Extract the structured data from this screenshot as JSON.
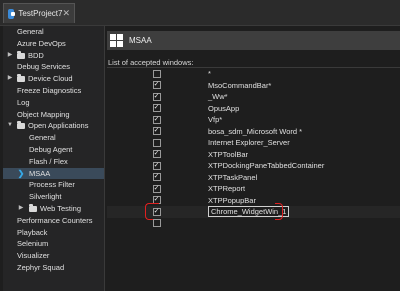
{
  "tab": {
    "title": "TestProject7",
    "close": "✕"
  },
  "sidebar": {
    "items": [
      {
        "label": "General",
        "level": 0,
        "arrow": "",
        "folder": false,
        "selected": false
      },
      {
        "label": "Azure DevOps",
        "level": 0,
        "arrow": "",
        "folder": false,
        "selected": false
      },
      {
        "label": "BDD",
        "level": 0,
        "arrow": "▶",
        "folder": true,
        "selected": false
      },
      {
        "label": "Debug Services",
        "level": 0,
        "arrow": "",
        "folder": false,
        "selected": false
      },
      {
        "label": "Device Cloud",
        "level": 0,
        "arrow": "▶",
        "folder": true,
        "selected": false
      },
      {
        "label": "Freeze Diagnostics",
        "level": 0,
        "arrow": "",
        "folder": false,
        "selected": false
      },
      {
        "label": "Log",
        "level": 0,
        "arrow": "",
        "folder": false,
        "selected": false
      },
      {
        "label": "Object Mapping",
        "level": 0,
        "arrow": "",
        "folder": false,
        "selected": false
      },
      {
        "label": "Open Applications",
        "level": 0,
        "arrow": "▼",
        "folder": true,
        "selected": false
      },
      {
        "label": "General",
        "level": 1,
        "arrow": "",
        "folder": false,
        "selected": false
      },
      {
        "label": "Debug Agent",
        "level": 1,
        "arrow": "",
        "folder": false,
        "selected": false
      },
      {
        "label": "Flash / Flex",
        "level": 1,
        "arrow": "",
        "folder": false,
        "selected": false
      },
      {
        "label": "MSAA",
        "level": 1,
        "arrow": "❯",
        "folder": false,
        "selected": true
      },
      {
        "label": "Process Filter",
        "level": 1,
        "arrow": "",
        "folder": false,
        "selected": false
      },
      {
        "label": "Silverlight",
        "level": 1,
        "arrow": "",
        "folder": false,
        "selected": false
      },
      {
        "label": "Web Testing",
        "level": 1,
        "arrow": "▶",
        "folder": true,
        "selected": false
      },
      {
        "label": "Performance Counters",
        "level": 0,
        "arrow": "",
        "folder": false,
        "selected": false
      },
      {
        "label": "Playback",
        "level": 0,
        "arrow": "",
        "folder": false,
        "selected": false
      },
      {
        "label": "Selenium",
        "level": 0,
        "arrow": "",
        "folder": false,
        "selected": false
      },
      {
        "label": "Visualizer",
        "level": 0,
        "arrow": "",
        "folder": false,
        "selected": false
      },
      {
        "label": "Zephyr Squad",
        "level": 0,
        "arrow": "",
        "folder": false,
        "selected": false
      }
    ]
  },
  "main": {
    "title": "MSAA",
    "list_label": "List of accepted windows:",
    "rows": [
      {
        "checked": false,
        "name": "*"
      },
      {
        "checked": true,
        "name": "MsoCommandBar*"
      },
      {
        "checked": true,
        "name": "_Ww*"
      },
      {
        "checked": true,
        "name": "OpusApp"
      },
      {
        "checked": true,
        "name": "Vfp*"
      },
      {
        "checked": true,
        "name": "bosa_sdm_Microsoft Word *"
      },
      {
        "checked": false,
        "name": "Internet Explorer_Server"
      },
      {
        "checked": true,
        "name": "XTPToolBar"
      },
      {
        "checked": true,
        "name": "XTPDockingPaneTabbedContainer"
      },
      {
        "checked": true,
        "name": "XTPTaskPanel"
      },
      {
        "checked": true,
        "name": "XTPReport"
      },
      {
        "checked": true,
        "name": "XTPPopupBar"
      },
      {
        "checked": true,
        "name": "Chrome_WidgetWin_1",
        "editing": true
      },
      {
        "checked": false,
        "name": ""
      }
    ]
  },
  "colors": {
    "accent": "#36a9e8",
    "highlight": "#e02020",
    "selected_bg": "#3a4a5a"
  }
}
